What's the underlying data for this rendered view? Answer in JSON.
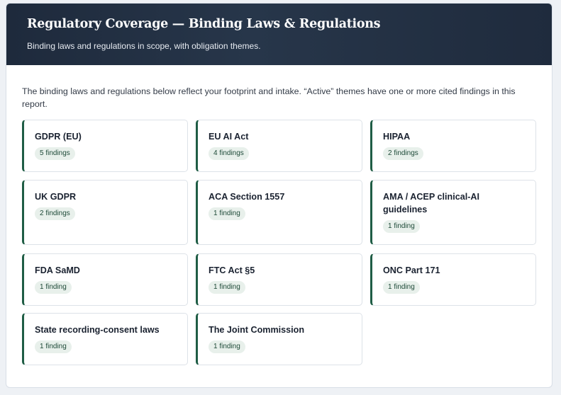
{
  "header": {
    "title": "Regulatory Coverage — Binding Laws & Regulations",
    "subtitle": "Binding laws and regulations in scope, with obligation themes."
  },
  "intro": "The binding laws and regulations below reflect your footprint and intake. “Active” themes have one or more cited findings in this report.",
  "colors": {
    "header_bg": "#1e2a3c",
    "card_accent": "#1f5d45",
    "badge_bg": "#e8f0eb",
    "badge_text": "#1e4a38"
  },
  "regulations": [
    {
      "name": "GDPR (EU)",
      "findings": "5 findings"
    },
    {
      "name": "EU AI Act",
      "findings": "4 findings"
    },
    {
      "name": "HIPAA",
      "findings": "2 findings"
    },
    {
      "name": "UK GDPR",
      "findings": "2 findings"
    },
    {
      "name": "ACA Section 1557",
      "findings": "1 finding"
    },
    {
      "name": "AMA / ACEP clinical-AI guidelines",
      "findings": "1 finding"
    },
    {
      "name": "FDA SaMD",
      "findings": "1 finding"
    },
    {
      "name": "FTC Act §5",
      "findings": "1 finding"
    },
    {
      "name": "ONC Part 171",
      "findings": "1 finding"
    },
    {
      "name": "State recording-consent laws",
      "findings": "1 finding"
    },
    {
      "name": "The Joint Commission",
      "findings": "1 finding"
    }
  ]
}
